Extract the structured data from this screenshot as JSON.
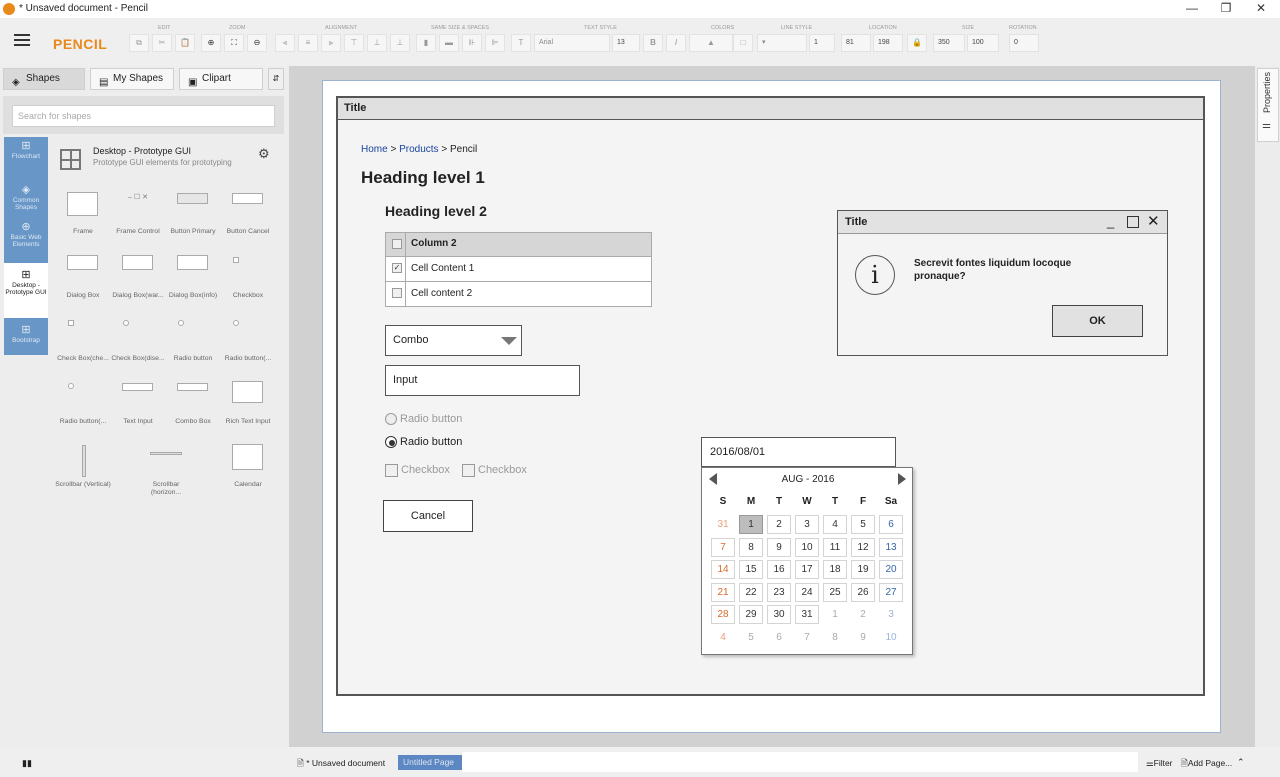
{
  "window": {
    "title": "* Unsaved document - Pencil",
    "controls": [
      "—",
      "❐",
      "✕"
    ]
  },
  "toolbar": {
    "brand": "PENCIL",
    "groups": [
      "EDIT",
      "ZOOM",
      "ALIGNMENT",
      "SAME SIZE & SPACES",
      "TEXT STYLE",
      "COLORS",
      "LINE STYLE",
      "LOCATION",
      "SIZE",
      "ROTATION"
    ],
    "font_name": "Arial",
    "font_size": "13",
    "line_width": "1",
    "loc_x": "81",
    "loc_y": "198",
    "width": "350",
    "height": "100",
    "rotation": "0"
  },
  "left_panel": {
    "tabs": [
      "Shapes",
      "My Shapes",
      "Clipart"
    ],
    "pin": "⇵",
    "search_placeholder": "Search for shapes",
    "categories": [
      {
        "label": "Flowchart",
        "icon": "⊞"
      },
      {
        "label": "Common Shapes",
        "icon": "◈"
      },
      {
        "label": "Basic Web Elements",
        "icon": "⊕"
      },
      {
        "label": "Desktop - Prototype GUI",
        "icon": "⊞"
      },
      {
        "label": "Bootstrap",
        "icon": "⊞"
      }
    ],
    "collection": {
      "title": "Desktop - Prototype GUI",
      "desc": "Prototype GUI elements for prototyping"
    },
    "shapes": [
      "Frame",
      "Frame Control",
      "Button Primary",
      "Button Cancel",
      "Dialog Box",
      "Dialog Box(war...",
      "Dialog Box(info)",
      "Checkbox",
      "Check Box(che...",
      "Check Box(dise...",
      "Radio button",
      "Radio button(...",
      "Radio button(...",
      "Text Input",
      "Combo Box",
      "Rich Text Input",
      "Scrollbar (Vertical)",
      "Scrollbar (horizon...",
      "Calendar"
    ]
  },
  "canvas": {
    "frame_title": "Title",
    "breadcrumb": {
      "home": "Home",
      "sep": ">",
      "products": "Products",
      "current": "Pencil"
    },
    "h1": "Heading level 1",
    "h2": "Heading level 2",
    "table": {
      "header": "Column 2",
      "rows": [
        "Cell Content 1",
        "Cell content 2"
      ]
    },
    "combo": "Combo",
    "input": "Input",
    "radio1": "Radio button",
    "radio2": "Radio button",
    "checkbox1": "Checkbox",
    "checkbox2": "Checkbox",
    "cancel": "Cancel",
    "dialog": {
      "title": "Title",
      "message": "Secrevit fontes liquidum locoque pronaque?",
      "ok": "OK"
    },
    "date": {
      "value": "2016/08/01",
      "month": "AUG - 2016",
      "weekdays": [
        "S",
        "M",
        "T",
        "W",
        "T",
        "F",
        "Sa"
      ],
      "days": [
        [
          "31",
          "1",
          "2",
          "3",
          "4",
          "5",
          "6"
        ],
        [
          "7",
          "8",
          "9",
          "10",
          "11",
          "12",
          "13"
        ],
        [
          "14",
          "15",
          "16",
          "17",
          "18",
          "19",
          "20"
        ],
        [
          "21",
          "22",
          "23",
          "24",
          "25",
          "26",
          "27"
        ],
        [
          "28",
          "29",
          "30",
          "31",
          "1",
          "2",
          "3"
        ],
        [
          "4",
          "5",
          "6",
          "7",
          "8",
          "9",
          "10"
        ]
      ]
    }
  },
  "right_panel": {
    "label": "Properties"
  },
  "status": {
    "doc": "* Unsaved document",
    "page": "Untitled Page",
    "filter": "Filter",
    "add": "Add Page..."
  }
}
